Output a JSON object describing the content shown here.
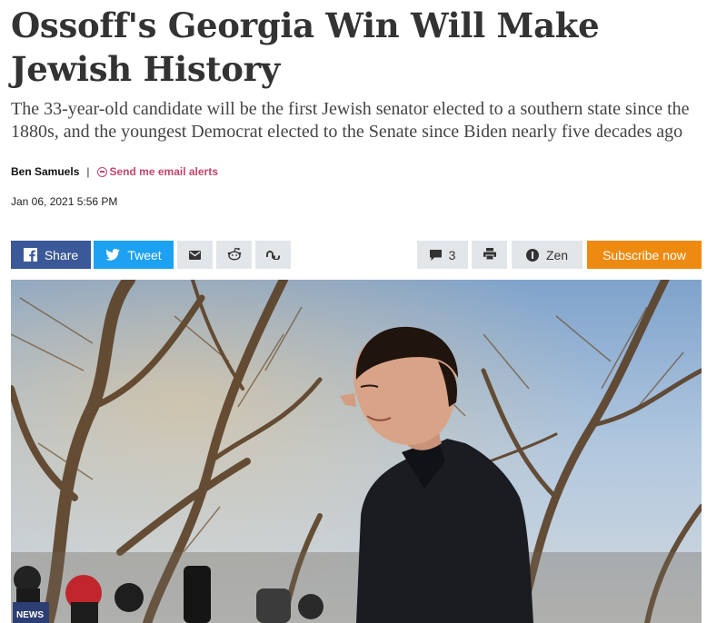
{
  "article": {
    "headline": "Ossoff's Georgia Win Will Make Jewish History",
    "dek": "The 33-year-old candidate will be the first Jewish senator elected to a southern state since the 1880s, and the youngest Democrat elected to the Senate since Biden nearly five decades ago",
    "author": "Ben Samuels",
    "separator": "|",
    "alerts_label": "Send me email alerts",
    "date": "Jan 06, 2021 5:56 PM"
  },
  "toolbar": {
    "share_label": "Share",
    "tweet_label": "Tweet",
    "comments_count": "3",
    "zen_label": "Zen",
    "subscribe_label": "Subscribe now"
  },
  "photo": {
    "mic_logo_text": "NEWS"
  },
  "colors": {
    "facebook": "#3b5998",
    "twitter": "#1da1f2",
    "subscribe": "#ee8a10",
    "alerts": "#c2466c",
    "button_grey": "#e3e6e8"
  },
  "icons": [
    "facebook-icon",
    "twitter-icon",
    "email-icon",
    "reddit-icon",
    "stumbleupon-icon",
    "comment-icon",
    "print-icon",
    "info-icon",
    "minus-circle-icon"
  ]
}
